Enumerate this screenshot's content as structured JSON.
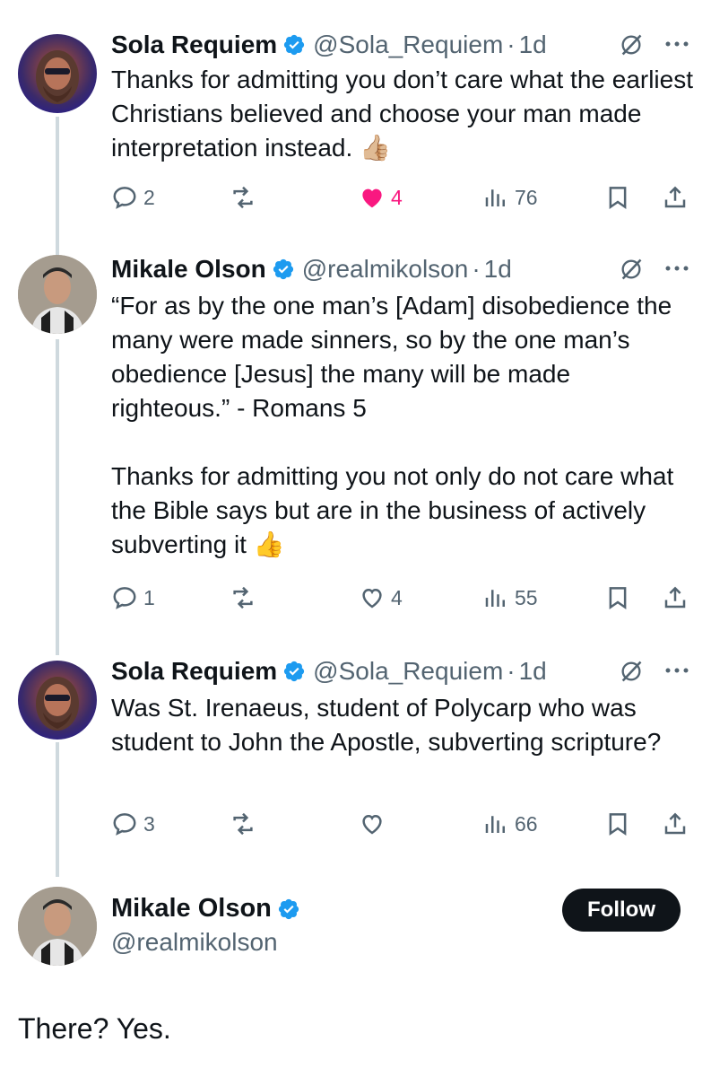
{
  "colors": {
    "text": "#0f1419",
    "secondary": "#536471",
    "verified": "#1d9bf0",
    "like": "#f91880",
    "thread_line": "#cfd9de",
    "follow_bg": "#0f1419"
  },
  "tweets": [
    {
      "name": "Sola Requiem",
      "handle": "@Sola_Requiem",
      "dot": "·",
      "time": "1d",
      "lines": [
        "Thanks for admitting you don’t care what the earliest Christians believed and choose your man made interpretation instead. 👍🏼"
      ],
      "replies": "2",
      "retweets": "",
      "likes": "4",
      "liked": true,
      "views": "76"
    },
    {
      "name": "Mikale Olson",
      "handle": "@realmikolson",
      "dot": "·",
      "time": "1d",
      "lines": [
        "“For as by the one man’s [Adam] disobedience the many were made sinners, so by the one man’s obedience [Jesus] the many will be made righteous.” - Romans 5",
        "Thanks for admitting you not only do not care what the Bible says but are in the business of actively subverting it 👍"
      ],
      "replies": "1",
      "retweets": "",
      "likes": "4",
      "liked": false,
      "views": "55"
    },
    {
      "name": "Sola Requiem",
      "handle": "@Sola_Requiem",
      "dot": "·",
      "time": "1d",
      "lines": [
        "Was St. Irenaeus, student of Polycarp who was student to John the Apostle, subverting scripture?"
      ],
      "replies": "3",
      "retweets": "",
      "likes": "",
      "liked": false,
      "views": "66"
    }
  ],
  "main_tweet": {
    "name": "Mikale Olson",
    "handle": "@realmikolson",
    "follow_label": "Follow",
    "text": "There? Yes."
  },
  "icons": {
    "verified": "verified-badge-icon",
    "grok": "grok-icon",
    "more": "more-icon",
    "reply": "reply-icon",
    "retweet": "retweet-icon",
    "like": "heart-icon",
    "views": "views-icon",
    "bookmark": "bookmark-icon",
    "share": "share-icon"
  }
}
